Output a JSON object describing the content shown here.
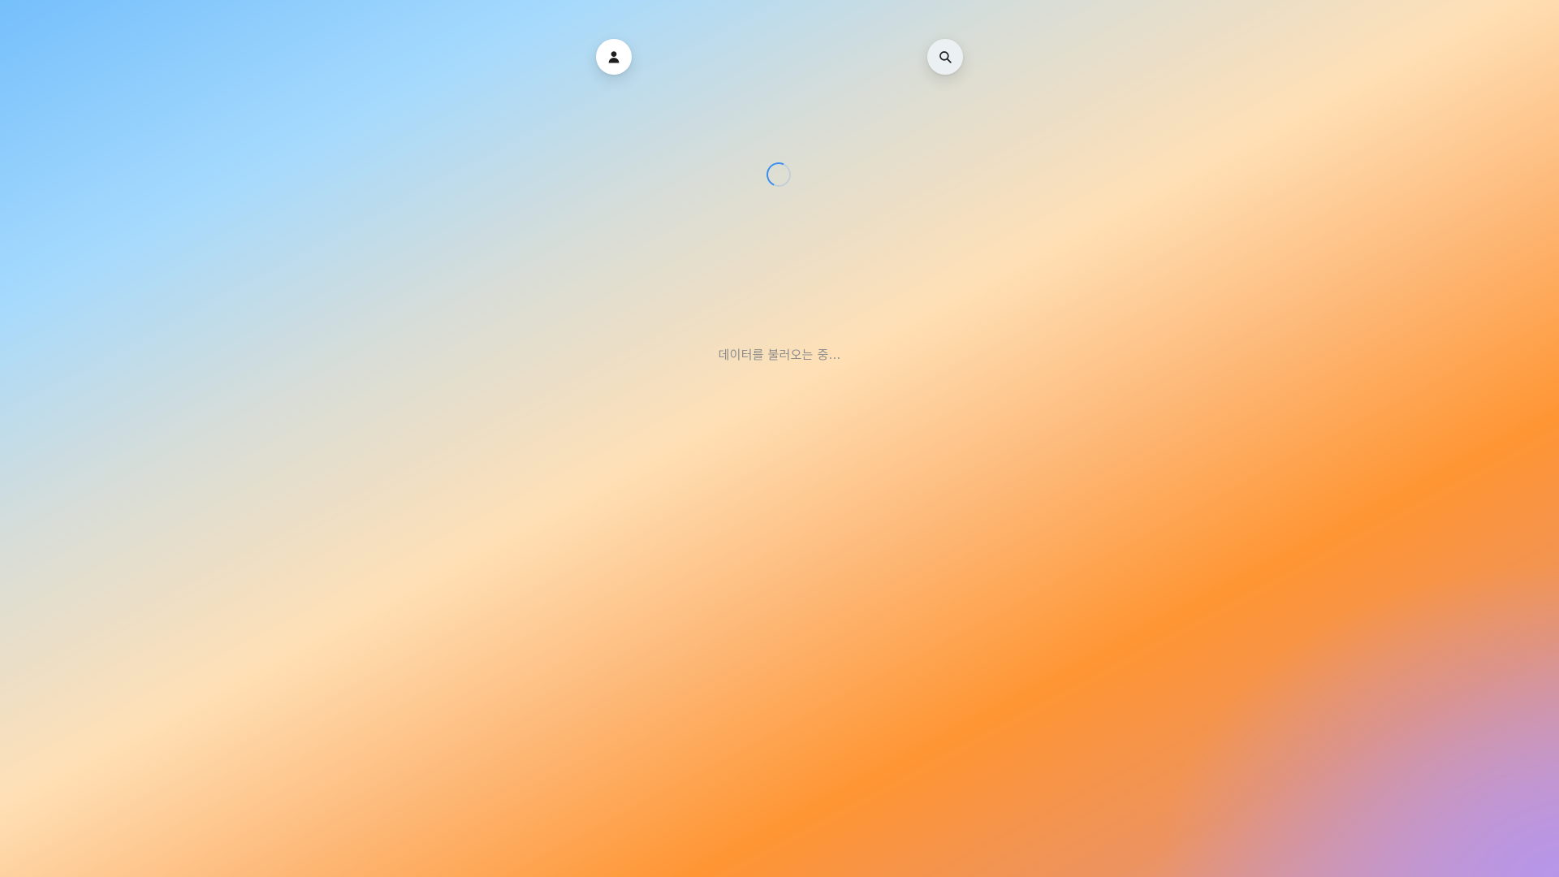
{
  "header": {
    "profile_icon": "person-icon",
    "search_icon": "search-icon"
  },
  "main": {
    "loading_text": "데이터를 불러오는 중..."
  },
  "colors": {
    "spinner_accent": "#3a8ef0",
    "background_top_left": "#75bffc",
    "background_middle": "#ffe0b6",
    "background_bottom_right": "#ff9533"
  }
}
